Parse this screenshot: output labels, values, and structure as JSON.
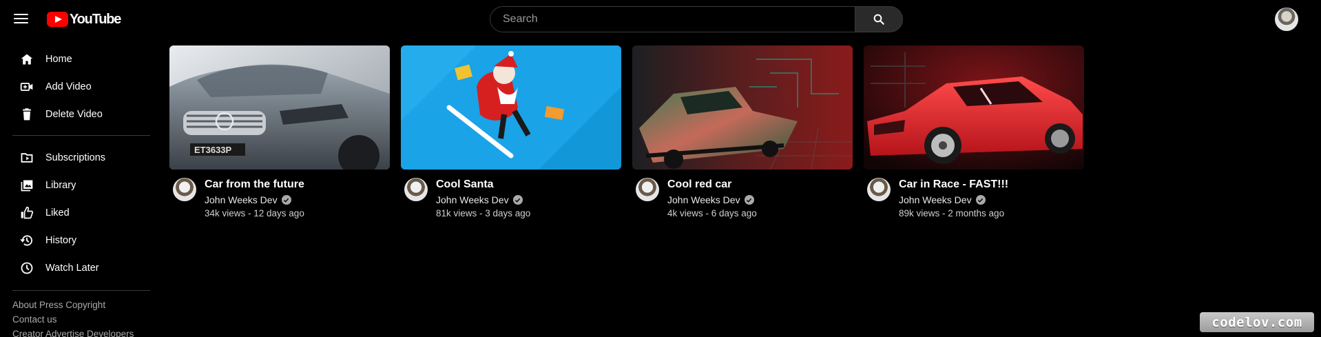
{
  "header": {
    "logo_text": "YouTube",
    "search_placeholder": "Search"
  },
  "sidebar": {
    "primary": [
      {
        "label": "Home",
        "icon": "home-icon"
      },
      {
        "label": "Add Video",
        "icon": "add-video-icon"
      },
      {
        "label": "Delete Video",
        "icon": "trash-icon"
      }
    ],
    "secondary": [
      {
        "label": "Subscriptions",
        "icon": "subscriptions-icon"
      },
      {
        "label": "Library",
        "icon": "library-icon"
      },
      {
        "label": "Liked",
        "icon": "thumbs-up-icon"
      },
      {
        "label": "History",
        "icon": "history-icon"
      },
      {
        "label": "Watch Later",
        "icon": "clock-icon"
      }
    ],
    "footer": {
      "line1": "About Press Copyright",
      "line2": "Contact us",
      "line3": "Creator Advertise Developers"
    }
  },
  "videos": [
    {
      "title": "Car from the future",
      "channel": "John Weeks Dev",
      "stats": "34k views - 12 days ago",
      "thumb": "silver-mercedes-car"
    },
    {
      "title": "Cool Santa",
      "channel": "John Weeks Dev",
      "stats": "81k views - 3 days ago",
      "thumb": "santa-snowboard"
    },
    {
      "title": "Cool red car",
      "channel": "John Weeks Dev",
      "stats": "4k views - 6 days ago",
      "thumb": "psychedelic-sports-car"
    },
    {
      "title": "Car in Race - FAST!!!",
      "channel": "John Weeks Dev",
      "stats": "89k views - 2 months ago",
      "thumb": "red-sedan"
    }
  ],
  "watermark": "codelov.com"
}
